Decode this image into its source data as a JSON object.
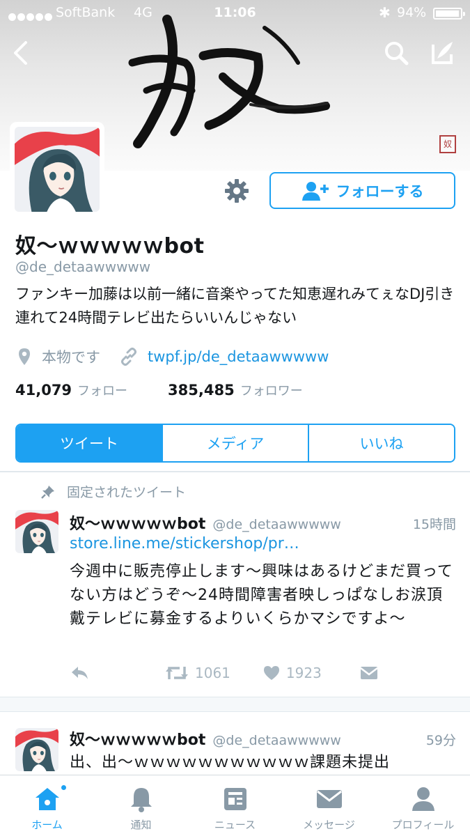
{
  "status_bar": {
    "carrier": "SoftBank",
    "network": "4G",
    "time": "11:06",
    "battery": "94%"
  },
  "header": {
    "seal_text": "奴"
  },
  "profile": {
    "follow_label": "フォローする",
    "name": "奴〜ｗｗｗｗｗbot",
    "handle": "@de_detaawwwww",
    "bio": "ファンキー加藤は以前一緒に音楽やってた知恵遅れみてぇなDJ引き連れて24時間テレビ出たらいいんじゃない",
    "location": "本物です",
    "url": "twpf.jp/de_detaawwwww",
    "following_count": "41,079",
    "following_label": "フォロー",
    "followers_count": "385,485",
    "followers_label": "フォロワー"
  },
  "tabs": [
    {
      "label": "ツイート",
      "active": true
    },
    {
      "label": "メディア",
      "active": false
    },
    {
      "label": "いいね",
      "active": false
    }
  ],
  "pinned_label": "固定されたツイート",
  "tweets": [
    {
      "name": "奴〜ｗｗｗｗｗbot",
      "handle": "@de_detaawwwww",
      "time": "15時間",
      "link": "store.line.me/stickershop/pr…",
      "text": "今週中に販売停止します〜興味はあるけどまだ買ってない方はどうぞ〜24時間障害者映しっぱなしお涙頂戴テレビに募金するよりいくらかマシですよ〜",
      "retweets": "1061",
      "likes": "1923"
    },
    {
      "name": "奴〜ｗｗｗｗｗbot",
      "handle": "@de_detaawwwww",
      "time": "59分",
      "text": "出、出〜ｗｗｗｗｗｗｗｗｗｗｗ課題未提出"
    }
  ],
  "tab_bar": [
    {
      "label": "ホーム",
      "icon": "home-icon",
      "active": true
    },
    {
      "label": "通知",
      "icon": "bell-icon",
      "active": false
    },
    {
      "label": "ニュース",
      "icon": "news-icon",
      "active": false
    },
    {
      "label": "メッセージ",
      "icon": "envelope-icon",
      "active": false
    },
    {
      "label": "プロフィール",
      "icon": "person-icon",
      "active": false
    }
  ],
  "colors": {
    "accent": "#1da1f2",
    "link": "#1b95e0",
    "muted": "#8899a6"
  }
}
